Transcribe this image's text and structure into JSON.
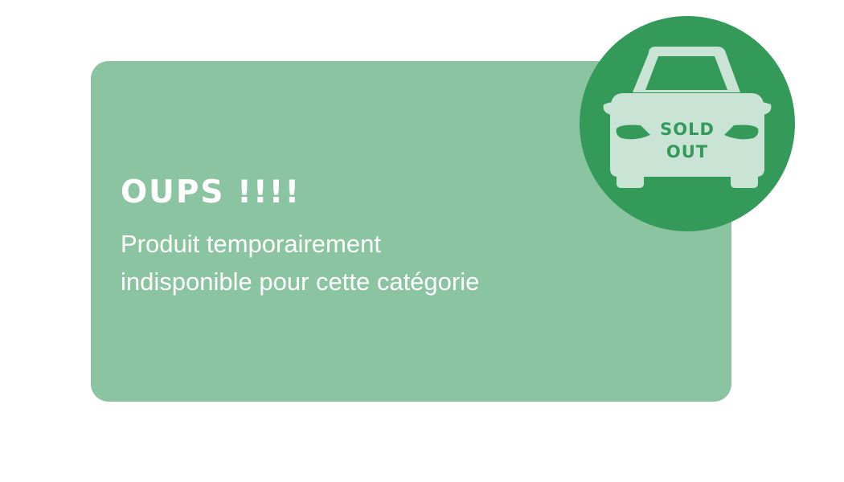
{
  "message_card": {
    "heading": "OUPS !!!!",
    "message_line_1": "Produit temporairement",
    "message_line_2": "indisponible pour cette catégorie"
  },
  "sold_out_badge": {
    "line_1": "SOLD",
    "line_2": "OUT",
    "icon": "car-front-icon"
  },
  "colors": {
    "card_background": "#8bc4a1",
    "badge_background": "#349a5a",
    "car_fill": "#c9e4d5",
    "text": "#ffffff"
  }
}
